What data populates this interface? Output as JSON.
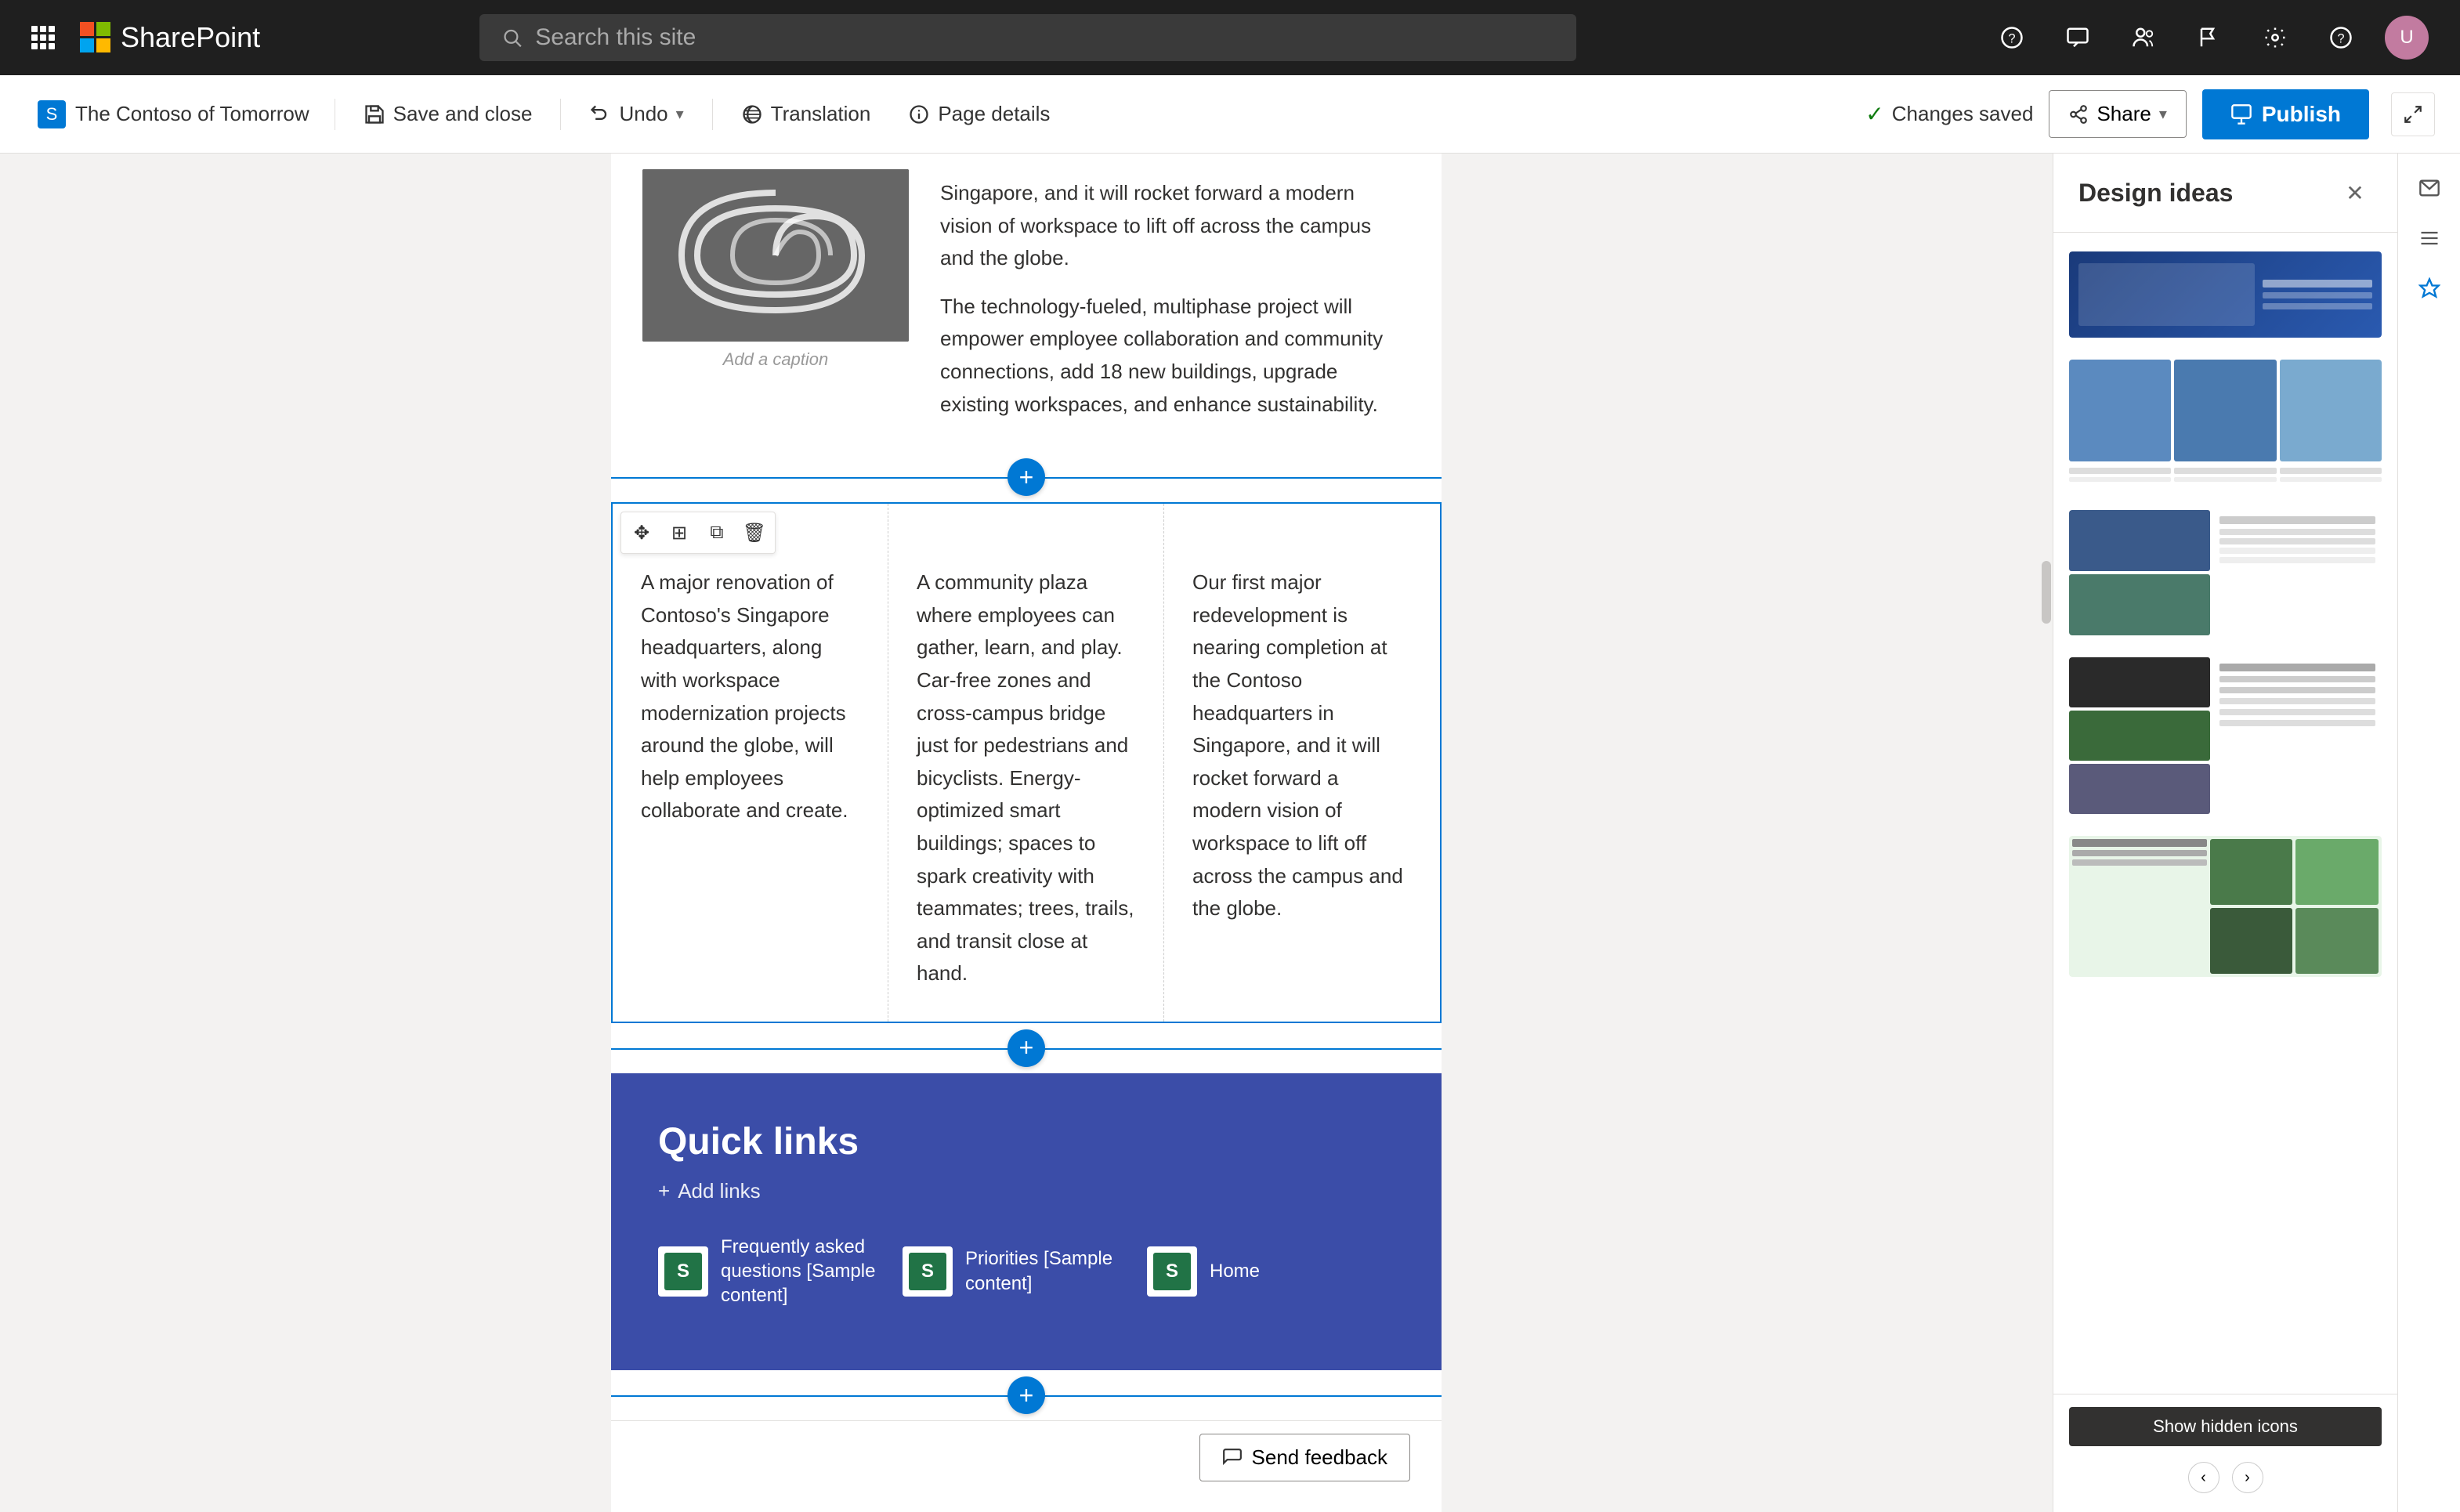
{
  "topnav": {
    "app_title": "SharePoint",
    "search_placeholder": "Search this site"
  },
  "toolbar": {
    "site_name": "The Contoso of Tomorrow",
    "save_close": "Save and close",
    "undo": "Undo",
    "translation": "Translation",
    "page_details": "Page details",
    "changes_saved": "Changes saved",
    "share": "Share",
    "publish": "Publish"
  },
  "design_panel": {
    "title": "Design ideas",
    "close_label": "Close"
  },
  "content": {
    "caption": "Add a caption",
    "paragraph1": "Singapore, and it will rocket forward a modern vision of workspace to lift off across the campus and the globe.",
    "paragraph2": "The technology-fueled, multiphase project will empower employee collaboration and community connections, add 18 new buildings, upgrade existing workspaces, and enhance sustainability.",
    "col1": "A major renovation of Contoso's Singapore headquarters, along with workspace modernization projects around the globe, will help employees collaborate and create.",
    "col2": "A community plaza where employees can gather, learn, and play. Car-free zones and cross-campus bridge just for pedestrians and bicyclists. Energy-optimized smart buildings; spaces to spark creativity with teammates; trees, trails, and transit close at hand.",
    "col3": "Our first major redevelopment is nearing completion at the Contoso headquarters in Singapore, and it will rocket forward a modern vision of workspace to lift off across the campus and the globe."
  },
  "quick_links": {
    "section_title": "Quick links",
    "add_links": "Add links",
    "links": [
      {
        "label": "Frequently asked questions [Sample content]"
      },
      {
        "label": "Priorities [Sample content]"
      },
      {
        "label": "Home"
      }
    ]
  },
  "feedback": {
    "label": "Send feedback"
  },
  "show_hidden": {
    "label": "Show hidden icons"
  }
}
